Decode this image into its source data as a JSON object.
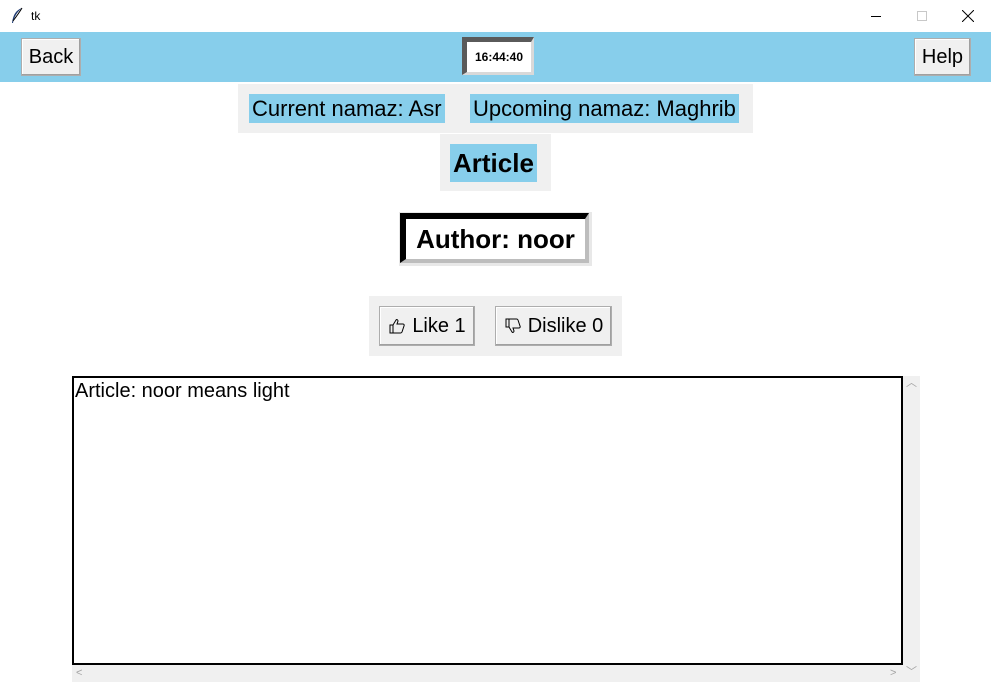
{
  "window": {
    "title": "tk",
    "app_icon": "feather-icon",
    "controls": [
      "minimize-icon",
      "maximize-icon",
      "close-icon"
    ]
  },
  "topbar": {
    "back_label": "Back",
    "help_label": "Help",
    "clock": "16:44:40",
    "bg_color": "#87ceeb"
  },
  "namaz": {
    "current": "Current namaz: Asr",
    "upcoming": "Upcoming namaz: Maghrib"
  },
  "article": {
    "heading": "Article",
    "author": "Author: noor",
    "like_label": "Like 1",
    "dislike_label": "Dislike 0",
    "like_icon": "thumbs-up-icon",
    "dislike_icon": "thumbs-down-icon",
    "body": "Article: noor means light"
  }
}
